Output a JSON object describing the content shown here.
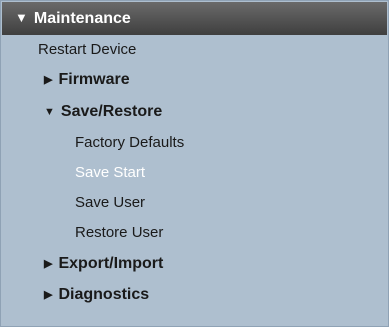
{
  "menu": {
    "header": {
      "label": "Maintenance",
      "expanded_icon": "▼"
    },
    "items": [
      {
        "label": "Restart Device"
      },
      {
        "label": "Firmware",
        "icon": "▶"
      },
      {
        "label": "Save/Restore",
        "icon": "▼",
        "children": [
          {
            "label": "Factory Defaults"
          },
          {
            "label": "Save Start"
          },
          {
            "label": "Save User"
          },
          {
            "label": "Restore User"
          }
        ]
      },
      {
        "label": "Export/Import",
        "icon": "▶"
      },
      {
        "label": "Diagnostics",
        "icon": "▶"
      }
    ]
  },
  "colors": {
    "panel_bg": "#aebfcf",
    "header_bg": "#4f4f4f",
    "header_text": "#ffffff",
    "active_text": "#ffffff",
    "item_text": "#1a1a1a"
  }
}
